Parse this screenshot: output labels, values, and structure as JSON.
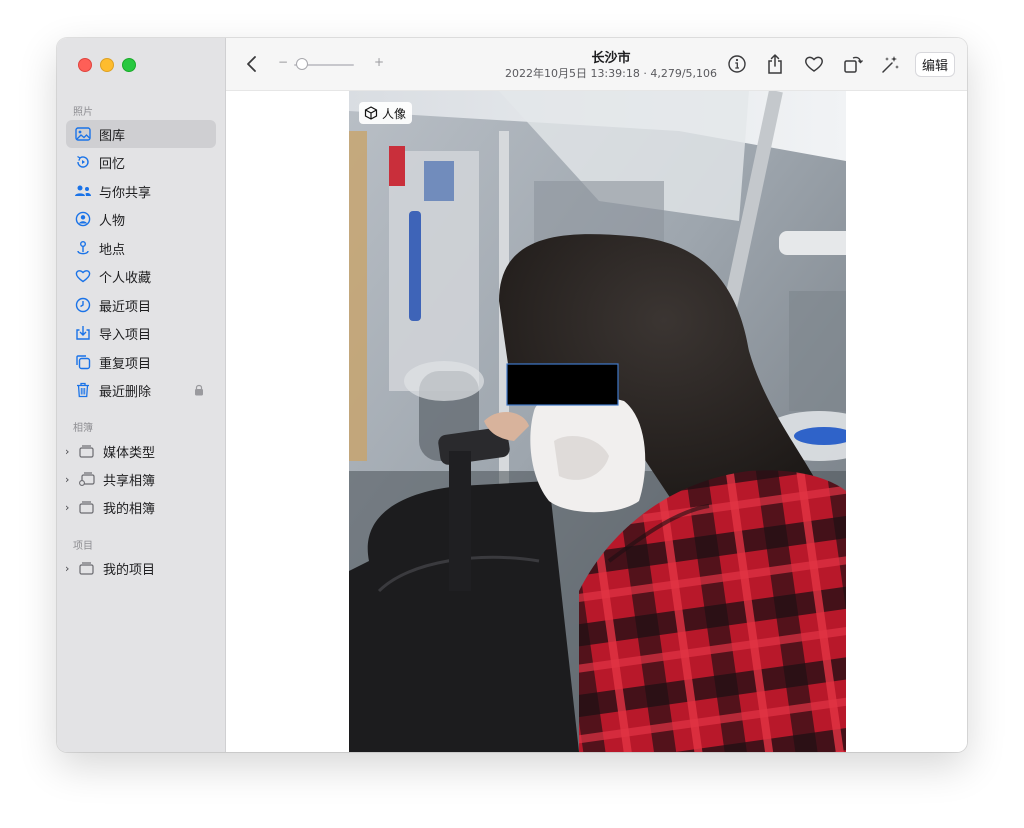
{
  "sidebar": {
    "photos_header": "照片",
    "library_items": [
      {
        "label": "图库",
        "icon": "photo-library-icon",
        "selected": true
      },
      {
        "label": "回忆",
        "icon": "memories-icon",
        "selected": false
      },
      {
        "label": "与你共享",
        "icon": "shared-with-you-icon",
        "selected": false
      },
      {
        "label": "人物",
        "icon": "people-icon",
        "selected": false
      },
      {
        "label": "地点",
        "icon": "places-icon",
        "selected": false
      },
      {
        "label": "个人收藏",
        "icon": "heart-icon",
        "selected": false
      },
      {
        "label": "最近项目",
        "icon": "clock-icon",
        "selected": false
      },
      {
        "label": "导入项目",
        "icon": "import-icon",
        "selected": false
      },
      {
        "label": "重复项目",
        "icon": "duplicates-icon",
        "selected": false
      },
      {
        "label": "最近删除",
        "icon": "trash-icon",
        "selected": false,
        "locked": true
      }
    ],
    "albums_header": "相簿",
    "album_items": [
      {
        "label": "媒体类型",
        "icon": "folder-icon"
      },
      {
        "label": "共享相簿",
        "icon": "shared-folder-icon"
      },
      {
        "label": "我的相簿",
        "icon": "folder-icon"
      }
    ],
    "projects_header": "项目",
    "project_items": [
      {
        "label": "我的项目",
        "icon": "folder-icon"
      }
    ]
  },
  "toolbar": {
    "title": "长沙市",
    "subtitle": "2022年10月5日 13:39:18 · 4,279/5,106",
    "zoom_minus": "−",
    "zoom_plus": "+",
    "zoom_level": 0.1,
    "edit_label": "编辑",
    "icons": [
      "info-icon",
      "share-icon",
      "favorite-heart-icon",
      "rotate-icon",
      "auto-enhance-icon"
    ]
  },
  "photo": {
    "badge_label": "人像",
    "badge_icon": "cube-icon"
  },
  "colors": {
    "accent": "#1a73e8",
    "sidebar_bg": "#e3e3e5",
    "selected_bg": "#cfcfd2"
  }
}
